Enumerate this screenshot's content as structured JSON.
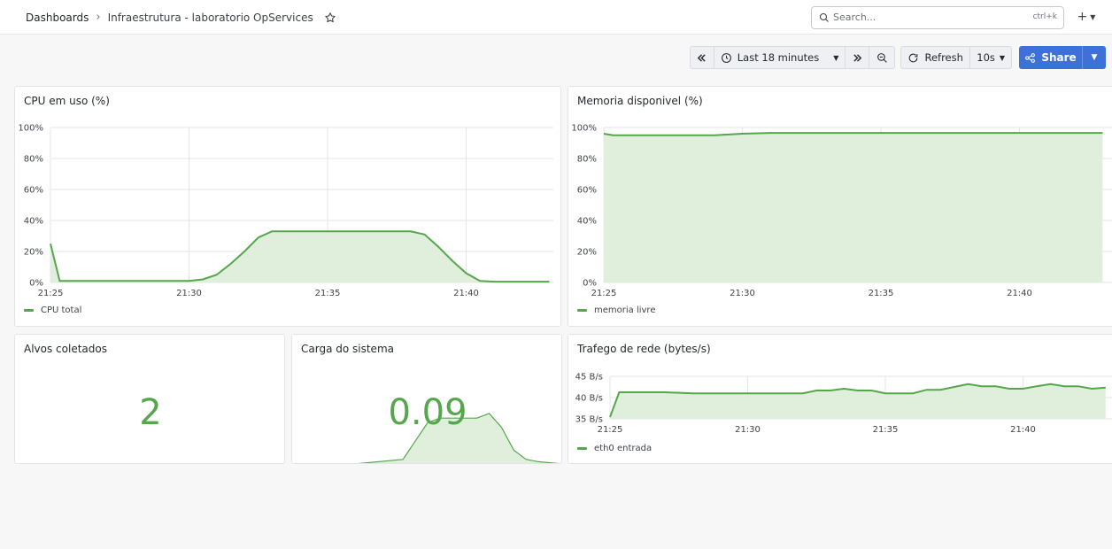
{
  "breadcrumb": {
    "root": "Dashboards",
    "current": "Infraestrutura - laboratorio OpServices"
  },
  "search": {
    "placeholder": "Search...",
    "shortcut": "ctrl+k"
  },
  "toolbar": {
    "time_range": "Last 18 minutes",
    "refresh_label": "Refresh",
    "refresh_interval": "10s",
    "share_label": "Share"
  },
  "colors": {
    "series": "#56a64b",
    "fill": "#e0efdc",
    "accent": "#3d71d9"
  },
  "panels": {
    "cpu": {
      "title": "CPU em uso (%)",
      "legend": "CPU total",
      "y_ticks": [
        "100%",
        "80%",
        "60%",
        "40%",
        "20%",
        "0%"
      ],
      "x_ticks": [
        "21:25",
        "21:30",
        "21:35",
        "21:40"
      ]
    },
    "mem": {
      "title": "Memoria disponivel (%)",
      "legend": "memoria livre",
      "y_ticks": [
        "100%",
        "80%",
        "60%",
        "40%",
        "20%",
        "0%"
      ],
      "x_ticks": [
        "21:25",
        "21:30",
        "21:35",
        "21:40"
      ]
    },
    "alvos": {
      "title": "Alvos coletados",
      "value": "2"
    },
    "carga": {
      "title": "Carga do sistema",
      "value": "0.09"
    },
    "rede": {
      "title": "Trafego de rede (bytes/s)",
      "legend": "eth0 entrada",
      "y_ticks": [
        "45 B/s",
        "40 B/s",
        "35 B/s"
      ],
      "x_ticks": [
        "21:25",
        "21:30",
        "21:35",
        "21:40"
      ]
    }
  },
  "chart_data": [
    {
      "type": "area",
      "title": "CPU em uso (%)",
      "ylim": [
        0,
        100
      ],
      "x_range": [
        "21:25",
        "21:43"
      ],
      "series": [
        {
          "name": "CPU total",
          "x": [
            "21:25:00",
            "21:25:20",
            "21:26:00",
            "21:30:00",
            "21:30:30",
            "21:31:00",
            "21:31:30",
            "21:32:00",
            "21:32:30",
            "21:33:00",
            "21:35:00",
            "21:37:00",
            "21:38:00",
            "21:38:30",
            "21:39:00",
            "21:39:30",
            "21:40:00",
            "21:40:30",
            "21:41:00",
            "21:43:00"
          ],
          "values": [
            25,
            1,
            1,
            1,
            2,
            5,
            12,
            20,
            29,
            33,
            33,
            33,
            33,
            31,
            23,
            14,
            6,
            1,
            0.5,
            0.5
          ]
        }
      ]
    },
    {
      "type": "area",
      "title": "Memoria disponivel (%)",
      "ylim": [
        0,
        100
      ],
      "x_range": [
        "21:25",
        "21:43"
      ],
      "series": [
        {
          "name": "memoria livre",
          "x": [
            "21:25:00",
            "21:25:20",
            "21:28:00",
            "21:29:00",
            "21:30:00",
            "21:31:00",
            "21:43:00"
          ],
          "values": [
            96,
            95,
            95,
            95,
            96,
            96.5,
            96.5
          ]
        }
      ]
    },
    {
      "type": "area",
      "title": "Carga do sistema",
      "series": [
        {
          "name": "",
          "x": [
            0,
            5,
            9,
            10,
            11,
            12,
            13,
            14,
            15,
            16,
            17,
            18,
            19,
            20,
            22
          ],
          "values": [
            0.0,
            0.0,
            0.01,
            0.05,
            0.09,
            0.1,
            0.1,
            0.1,
            0.1,
            0.11,
            0.08,
            0.03,
            0.01,
            0.005,
            0.0
          ]
        }
      ]
    },
    {
      "type": "area",
      "title": "Trafego de rede (bytes/s)",
      "ylim": [
        35,
        47
      ],
      "x_range": [
        "21:25",
        "21:43"
      ],
      "series": [
        {
          "name": "eth0 entrada",
          "x": [
            "21:25:00",
            "21:25:20",
            "21:27:00",
            "21:28:00",
            "21:29:00",
            "21:30:00",
            "21:31:00",
            "21:32:00",
            "21:32:30",
            "21:33:00",
            "21:33:30",
            "21:34:00",
            "21:34:30",
            "21:35:00",
            "21:36:00",
            "21:36:30",
            "21:37:00",
            "21:38:00",
            "21:38:30",
            "21:39:00",
            "21:39:30",
            "21:40:00",
            "21:40:30",
            "21:41:00",
            "21:41:30",
            "21:42:00",
            "21:42:30",
            "21:43:00"
          ],
          "values": [
            35.5,
            42.5,
            42.5,
            42.2,
            42.2,
            42.2,
            42.2,
            42.2,
            43.0,
            43.0,
            43.5,
            43.0,
            43.0,
            42.2,
            42.2,
            43.2,
            43.2,
            44.8,
            44.2,
            44.2,
            43.5,
            43.5,
            44.2,
            44.8,
            44.2,
            44.2,
            43.5,
            43.8
          ]
        }
      ]
    }
  ]
}
